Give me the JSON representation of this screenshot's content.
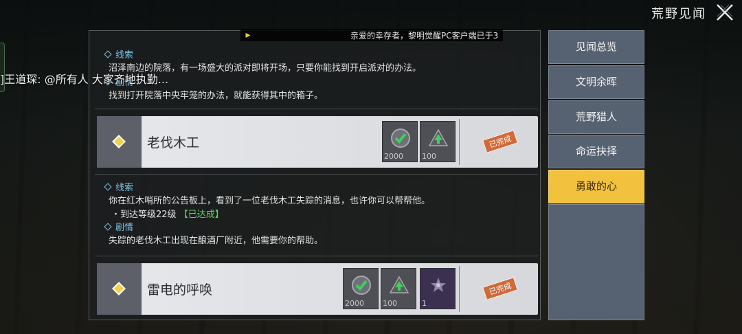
{
  "header": {
    "title": "荒野见闻"
  },
  "notice": {
    "text": "亲爱的幸存者，黎明觉醒PC客户端已于3"
  },
  "chat": {
    "text": "]王道琛: @所有人 大家齐地执勤..."
  },
  "quest_a_details": {
    "clue_label": "线索",
    "clue_text": "沼泽南边的院落，有一场盛大的派对即将开场，只要你能找到开启派对的办法。",
    "story_label": "剧情",
    "story_text": "找到打开院落中央牢笼的办法，就能获得其中的箱子。"
  },
  "quests": [
    {
      "name": "老伐木工",
      "status": "已完成",
      "rewards": [
        {
          "icon": "green-check-coin-icon",
          "count": "2000"
        },
        {
          "icon": "experience-arrow-icon",
          "count": "100"
        }
      ]
    },
    {
      "name": "雷电的呼唤",
      "status": "已完成",
      "rewards": [
        {
          "icon": "green-check-coin-icon",
          "count": "2000"
        },
        {
          "icon": "experience-arrow-icon",
          "count": "100"
        },
        {
          "icon": "purple-star-item-icon",
          "count": "1"
        }
      ]
    }
  ],
  "quest_b_details": {
    "clue_label": "线索",
    "clue_text": "你在红木哨所的公告板上，看到了一位老伐木工失踪的消息，也许你可以帮帮他。",
    "requirement": "・到达等级22级",
    "requirement_status": "【已达成】",
    "story_label": "剧情",
    "story_text": "失踪的老伐木工出现在酿酒厂附近，他需要你的帮助。"
  },
  "menu": {
    "items": [
      "见闻总览",
      "文明余晖",
      "荒野猎人",
      "命运抉择",
      "勇敢的心"
    ],
    "active_index": 4
  },
  "colors": {
    "accent": "#f2c23e",
    "menu_bg": "#566171",
    "clue_blue": "#7fc3e8",
    "done_green": "#5cd65c",
    "stamp": "#d06a3b"
  }
}
